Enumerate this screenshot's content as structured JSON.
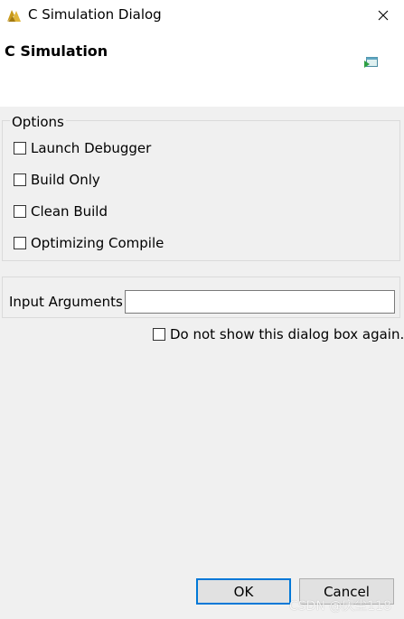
{
  "window": {
    "title": "C Simulation Dialog",
    "app_icon": "vivado-hls-logo-icon",
    "close_icon": "close-icon"
  },
  "header": {
    "title": "C Simulation",
    "icon": "run-simulation-icon"
  },
  "options": {
    "legend": "Options",
    "items": [
      {
        "label": "Launch Debugger",
        "checked": false
      },
      {
        "label": "Build Only",
        "checked": false
      },
      {
        "label": "Clean Build",
        "checked": false
      },
      {
        "label": "Optimizing Compile",
        "checked": false
      }
    ]
  },
  "arguments": {
    "label": "Input Arguments",
    "value": "",
    "placeholder": ""
  },
  "dont_show": {
    "label": "Do not show this dialog box again.",
    "checked": false
  },
  "buttons": {
    "ok": "OK",
    "cancel": "Cancel"
  },
  "watermark": "CSDN @庆尘118",
  "colors": {
    "dialog_bg": "#f0f0f0",
    "header_bg": "#ffffff",
    "default_button_border": "#0078d7"
  }
}
